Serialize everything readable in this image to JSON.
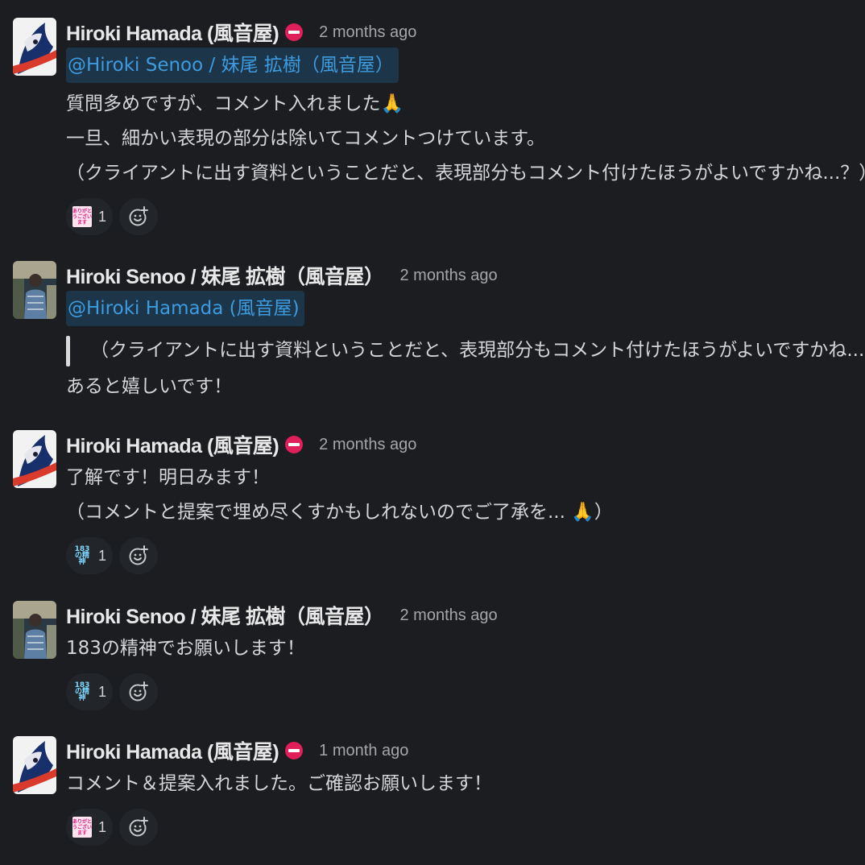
{
  "colors": {
    "background": "#1b1d21",
    "mention_bg": "#1d3549",
    "mention_text": "#3d9be0",
    "status_red": "#e01e5a"
  },
  "messages": [
    {
      "author": "Hiroki Hamada (風音屋)",
      "status_icon": "no-entry-icon",
      "time": "2 months ago",
      "mention": "@Hiroki Senoo / 妹尾 拡樹（風音屋）",
      "lines": [
        "質問多めですが、コメント入れました🙏",
        "一旦、細かい表現の部分は除いてコメントつけています。",
        "（クライアントに出す資料ということだと、表現部分もコメント付けたほうがよいですかね...？）"
      ],
      "reaction": {
        "emoji": "arigatou-gozaimasu-icon",
        "emoji_text": "ありがとうございます",
        "count": "1"
      }
    },
    {
      "author": "Hiroki Senoo / 妹尾 拡樹（風音屋）",
      "time": "2 months ago",
      "mention": "@Hiroki Hamada (風音屋)",
      "quote": "（クライアントに出す資料ということだと、表現部分もコメント付けたほうがよいですかね...？）",
      "lines": [
        "あると嬉しいです！"
      ]
    },
    {
      "author": "Hiroki Hamada (風音屋)",
      "status_icon": "no-entry-icon",
      "time": "2 months ago",
      "lines": [
        "了解です！明日みます！",
        "（コメントと提案で埋め尽くすかもしれないのでご了承を... 🙏）"
      ],
      "reaction": {
        "emoji": "183-no-seishin-icon",
        "emoji_text": "183の精神",
        "count": "1"
      }
    },
    {
      "author": "Hiroki Senoo / 妹尾 拡樹（風音屋）",
      "time": "2 months ago",
      "lines": [
        "183の精神でお願いします！"
      ],
      "reaction": {
        "emoji": "183-no-seishin-icon",
        "emoji_text": "183の精神",
        "count": "1"
      }
    },
    {
      "author": "Hiroki Hamada (風音屋)",
      "status_icon": "no-entry-icon",
      "time": "1 month ago",
      "lines": [
        "コメント＆提案入れました。ご確認お願いします！"
      ],
      "reaction": {
        "emoji": "arigatou-gozaimasu-icon",
        "emoji_text": "ありがとうございます",
        "count": "1"
      }
    }
  ]
}
